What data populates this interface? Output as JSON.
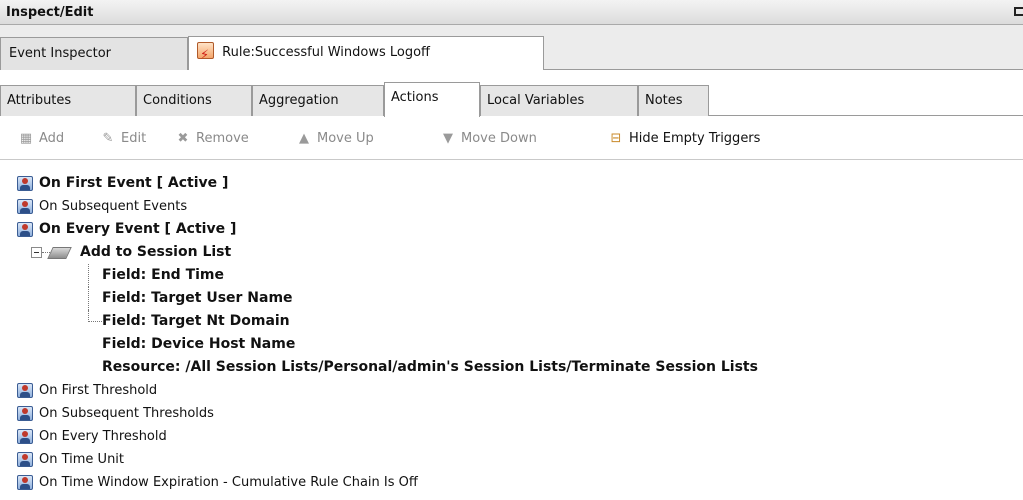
{
  "panel": {
    "title": "Inspect/Edit"
  },
  "top_tabs": [
    {
      "label": "Event Inspector"
    },
    {
      "label": "Rule:Successful Windows Logoff"
    }
  ],
  "sub_tabs": [
    {
      "label": "Attributes"
    },
    {
      "label": "Conditions"
    },
    {
      "label": "Aggregation"
    },
    {
      "label": "Actions"
    },
    {
      "label": "Local Variables"
    },
    {
      "label": "Notes"
    }
  ],
  "active_sub_tab": "Actions",
  "toolbar": {
    "add": "Add",
    "edit": "Edit",
    "remove": "Remove",
    "move_up": "Move Up",
    "move_down": "Move Down",
    "hide_empty": "Hide Empty Triggers"
  },
  "tree": {
    "triggers_top": [
      {
        "label": "On First Event [ Active ]"
      },
      {
        "label": "On Subsequent Events"
      },
      {
        "label": "On Every Event [ Active ]"
      }
    ],
    "action": {
      "label": "Add to Session List"
    },
    "fields": [
      {
        "label": "Field: End Time"
      },
      {
        "label": "Field: Target User Name"
      },
      {
        "label": "Field: Target Nt Domain"
      },
      {
        "label": "Field: Device Host Name"
      },
      {
        "label": "Resource: /All Session Lists/Personal/admin's Session Lists/Terminate Session Lists"
      }
    ],
    "triggers_bottom": [
      {
        "label": "On First Threshold"
      },
      {
        "label": "On Subsequent Thresholds"
      },
      {
        "label": "On Every Threshold"
      },
      {
        "label": "On Time Unit"
      },
      {
        "label": "On Time Window Expiration - Cumulative Rule Chain Is Off"
      }
    ]
  },
  "icons": {
    "rule": "rule-lightning-icon",
    "trigger": "trigger-person-icon",
    "action": "action-icon",
    "add": "add-icon",
    "edit": "pencil-icon",
    "remove": "remove-icon",
    "move_up": "triangle-up-icon",
    "move_down": "triangle-down-icon",
    "hide_empty": "hide-empty-icon"
  }
}
